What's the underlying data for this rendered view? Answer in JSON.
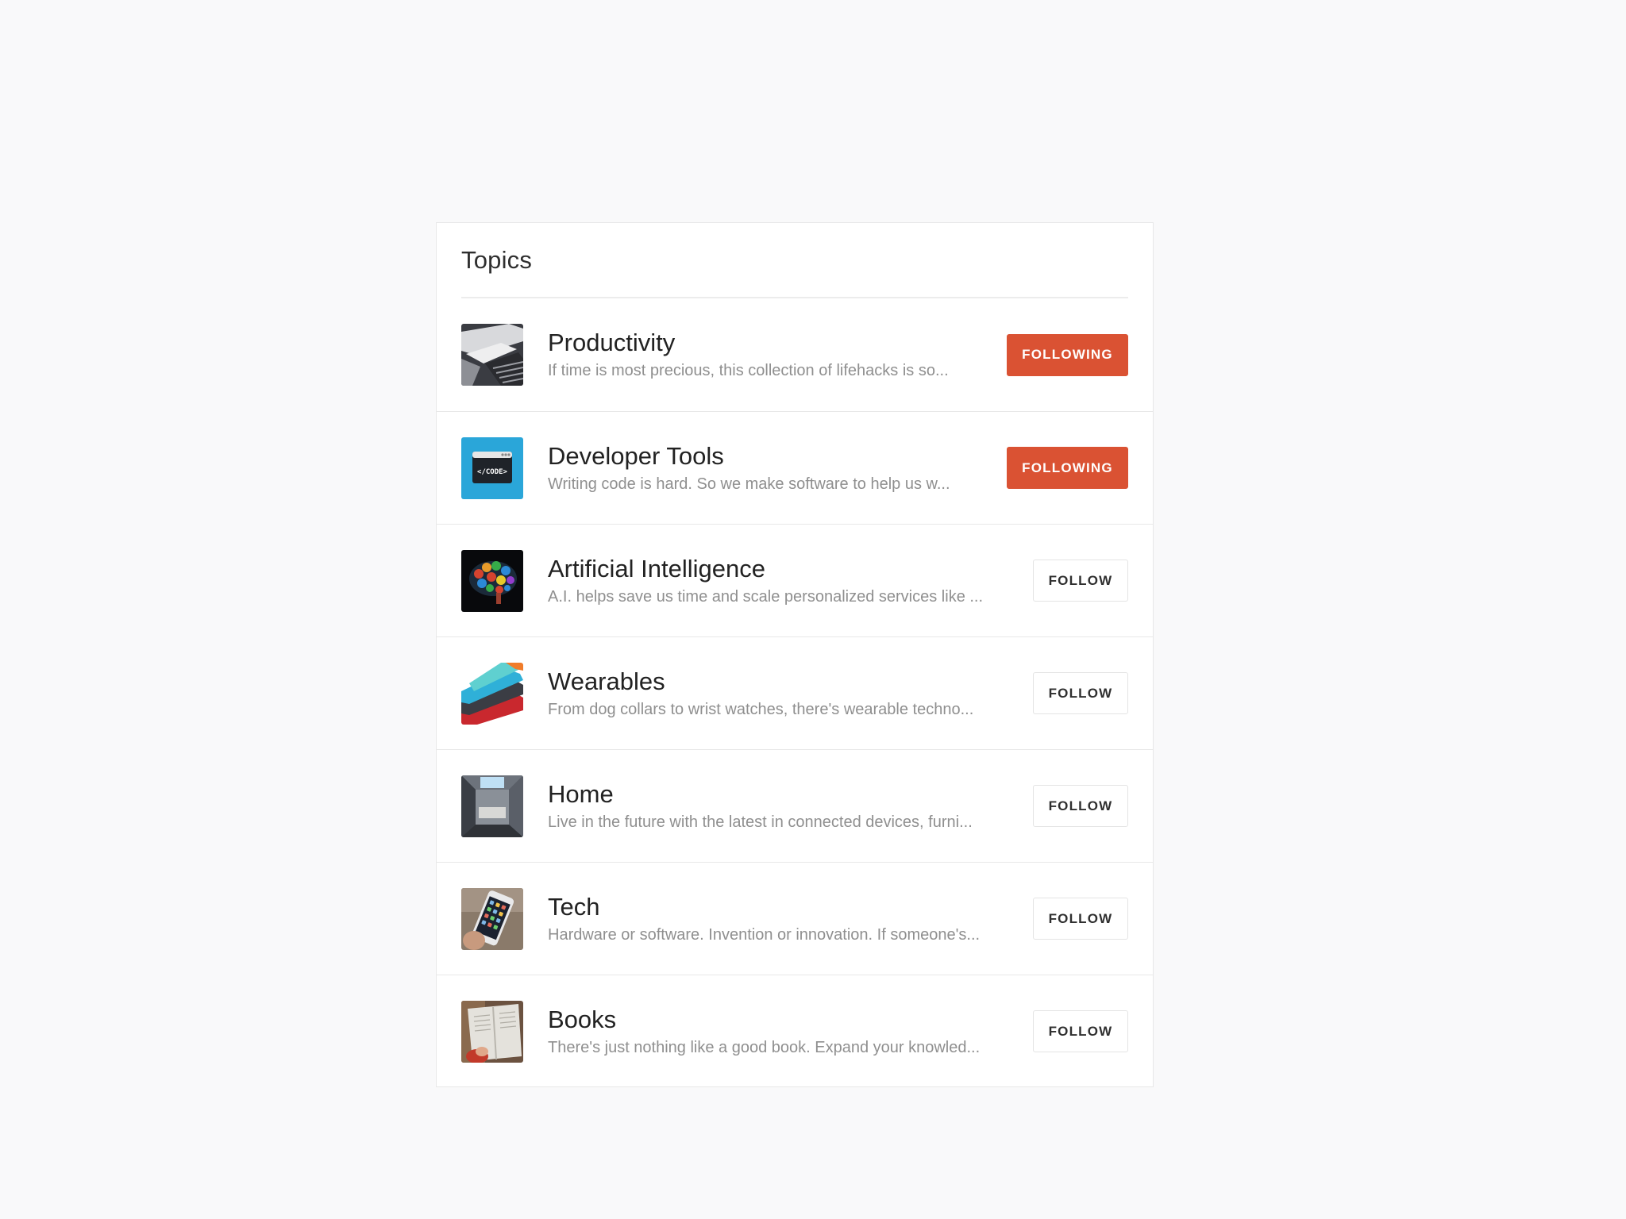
{
  "header": {
    "title": "Topics"
  },
  "topics": [
    {
      "name": "Productivity",
      "description": "If time is most precious, this collection of lifehacks is so...",
      "button_label": "FOLLOWING",
      "following": true,
      "thumbnail": "productivity-thumbnail"
    },
    {
      "name": "Developer Tools",
      "description": "Writing code is hard. So we make software to help us w...",
      "button_label": "FOLLOWING",
      "following": true,
      "thumbnail": "developer-tools-thumbnail",
      "thumbnail_text": "</CODE>"
    },
    {
      "name": "Artificial Intelligence",
      "description": "A.I. helps save us time and scale personalized services like ...",
      "button_label": "FOLLOW",
      "following": false,
      "thumbnail": "artificial-intelligence-thumbnail"
    },
    {
      "name": "Wearables",
      "description": "From dog collars to wrist watches, there's wearable techno...",
      "button_label": "FOLLOW",
      "following": false,
      "thumbnail": "wearables-thumbnail"
    },
    {
      "name": "Home",
      "description": "Live in the future with the latest in connected devices, furni...",
      "button_label": "FOLLOW",
      "following": false,
      "thumbnail": "home-thumbnail"
    },
    {
      "name": "Tech",
      "description": "Hardware or software. Invention or innovation. If someone's...",
      "button_label": "FOLLOW",
      "following": false,
      "thumbnail": "tech-thumbnail"
    },
    {
      "name": "Books",
      "description": "There's just nothing like a good book. Expand your knowled...",
      "button_label": "FOLLOW",
      "following": false,
      "thumbnail": "books-thumbnail"
    }
  ],
  "colors": {
    "following_button": "#da5233",
    "page_background": "#f9f9fa",
    "card_background": "#ffffff",
    "description_text": "#8f8f8f"
  }
}
